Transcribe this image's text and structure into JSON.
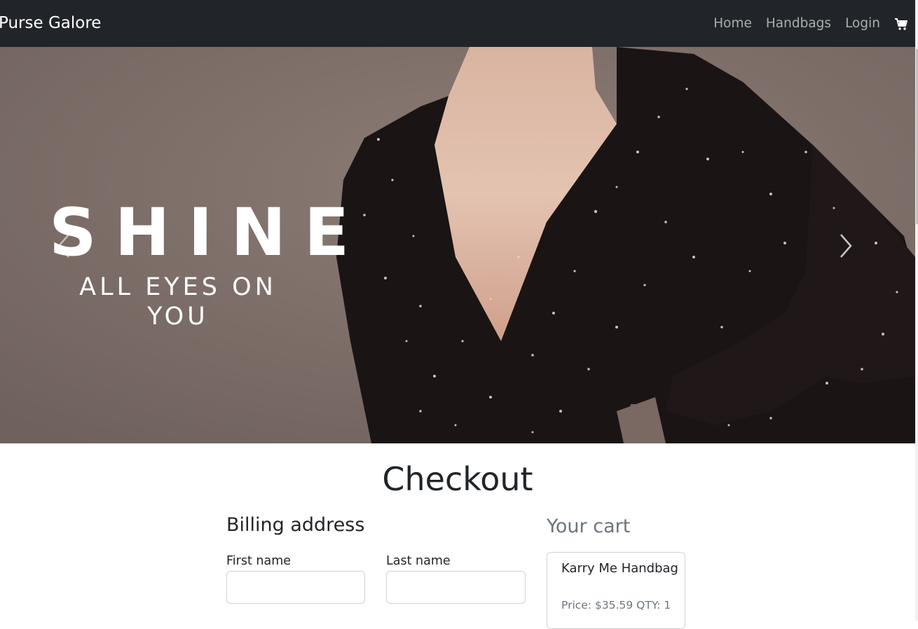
{
  "navbar": {
    "brand": "Purse Galore",
    "links": [
      "Home",
      "Handbags",
      "Login"
    ],
    "cart_icon": "cart-icon"
  },
  "hero": {
    "headline": "SHINE",
    "subheadline": "ALL EYES ON YOU",
    "prev_icon": "chevron-left-icon",
    "next_icon": "chevron-right-icon"
  },
  "checkout": {
    "title": "Checkout",
    "billing": {
      "title": "Billing address",
      "first_name_label": "First name",
      "first_name_value": "",
      "last_name_label": "Last name",
      "last_name_value": ""
    },
    "cart": {
      "title": "Your cart",
      "items": [
        {
          "name": "Karry Me Handbag",
          "price_label": "Price:",
          "price": "$35.59",
          "qty_label": "QTY:",
          "qty": "1"
        }
      ]
    }
  }
}
